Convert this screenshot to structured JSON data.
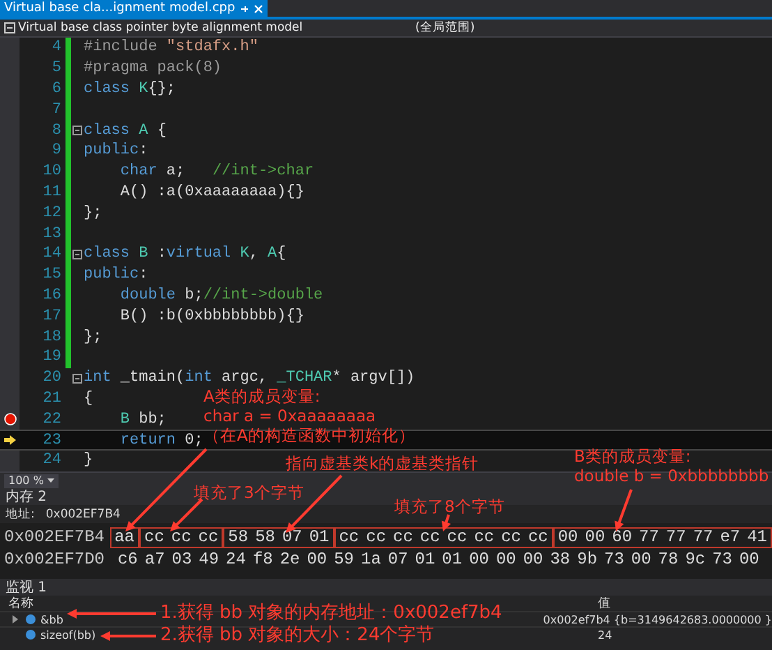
{
  "tab": {
    "title": "Virtual base cla...ignment model.cpp",
    "selected": true
  },
  "nav_bar": {
    "scope": "Virtual base class pointer byte alignment model",
    "member": "(全局范围)"
  },
  "code": {
    "lines": [
      {
        "number": "4",
        "changed": true,
        "tokens": [
          {
            "kind": "pp",
            "text": "#include "
          },
          {
            "kind": "str",
            "text": "\"stdafx.h\""
          }
        ]
      },
      {
        "number": "5",
        "changed": true,
        "tokens": [
          {
            "kind": "pp",
            "text": "#pragma pack(8)"
          }
        ]
      },
      {
        "number": "6",
        "changed": true,
        "tokens": [
          {
            "kind": "kw",
            "text": "class "
          },
          {
            "kind": "ty",
            "text": "K"
          },
          {
            "kind": "pl",
            "text": "{};"
          }
        ]
      },
      {
        "number": "7",
        "changed": true
      },
      {
        "number": "8",
        "changed": true,
        "fold": true,
        "tokens": [
          {
            "kind": "kw",
            "text": "class "
          },
          {
            "kind": "ty",
            "text": "A "
          },
          {
            "kind": "pl",
            "text": "{"
          }
        ]
      },
      {
        "number": "9",
        "changed": true,
        "tokens": [
          {
            "kind": "kw",
            "text": "public"
          },
          {
            "kind": "pl",
            "text": ":"
          }
        ]
      },
      {
        "number": "10",
        "changed": true,
        "tokens": [
          {
            "kind": "kw",
            "text": "    char "
          },
          {
            "kind": "pl",
            "text": "a;   "
          },
          {
            "kind": "cm",
            "text": "//int->char"
          }
        ]
      },
      {
        "number": "11",
        "changed": true,
        "tokens": [
          {
            "kind": "pl",
            "text": "    A() :a(0xaaaaaaaa){}"
          }
        ]
      },
      {
        "number": "12",
        "changed": true,
        "tokens": [
          {
            "kind": "pl",
            "text": "};"
          }
        ]
      },
      {
        "number": "13",
        "changed": true
      },
      {
        "number": "14",
        "changed": true,
        "fold": true,
        "tokens": [
          {
            "kind": "kw",
            "text": "class "
          },
          {
            "kind": "ty",
            "text": "B "
          },
          {
            "kind": "pl",
            "text": ":"
          },
          {
            "kind": "kw",
            "text": "virtual "
          },
          {
            "kind": "ty",
            "text": "K"
          },
          {
            "kind": "pl",
            "text": ", "
          },
          {
            "kind": "ty",
            "text": "A"
          },
          {
            "kind": "pl",
            "text": "{"
          }
        ]
      },
      {
        "number": "15",
        "changed": true,
        "tokens": [
          {
            "kind": "kw",
            "text": "public"
          },
          {
            "kind": "pl",
            "text": ":"
          }
        ]
      },
      {
        "number": "16",
        "changed": true,
        "tokens": [
          {
            "kind": "kw",
            "text": "    double "
          },
          {
            "kind": "pl",
            "text": "b;"
          },
          {
            "kind": "cm",
            "text": "//int->double"
          }
        ]
      },
      {
        "number": "17",
        "changed": true,
        "tokens": [
          {
            "kind": "pl",
            "text": "    B() :b(0xbbbbbbbb){}"
          }
        ]
      },
      {
        "number": "18",
        "changed": true,
        "tokens": [
          {
            "kind": "pl",
            "text": "};"
          }
        ]
      },
      {
        "number": "19",
        "changed": true
      },
      {
        "number": "20",
        "changed": false,
        "fold": true,
        "tokens": [
          {
            "kind": "kw",
            "text": "int "
          },
          {
            "kind": "pl",
            "text": "_tmain("
          },
          {
            "kind": "kw",
            "text": "int "
          },
          {
            "kind": "pl",
            "text": "argc, "
          },
          {
            "kind": "ty",
            "text": "_TCHAR"
          },
          {
            "kind": "pl",
            "text": "* argv[])"
          }
        ]
      },
      {
        "number": "21",
        "changed": false,
        "tokens": [
          {
            "kind": "pl",
            "text": "{"
          }
        ]
      },
      {
        "number": "22",
        "changed": false,
        "breakpoint": true,
        "tokens": [
          {
            "kind": "ty",
            "text": "    B "
          },
          {
            "kind": "pl",
            "text": "bb;"
          }
        ]
      },
      {
        "number": "23",
        "changed": false,
        "current": true,
        "tokens": [
          {
            "kind": "kw",
            "text": "    return "
          },
          {
            "kind": "pl",
            "text": "0;"
          }
        ]
      },
      {
        "number": "24",
        "changed": false,
        "tokens": [
          {
            "kind": "pl",
            "text": "}"
          }
        ]
      }
    ]
  },
  "zoom": "100 %",
  "memory": {
    "title": "内存 2",
    "address_label": "地址:",
    "address": "0x002EF7B4",
    "rows": [
      {
        "address": "0x002EF7B4",
        "groups": [
          {
            "boxed": true,
            "bytes": [
              "aa"
            ]
          },
          {
            "boxed": true,
            "bytes": [
              "cc",
              "cc",
              "cc"
            ]
          },
          {
            "boxed": true,
            "bytes": [
              "58",
              "58",
              "07",
              "01"
            ]
          },
          {
            "boxed": true,
            "bytes": [
              "cc",
              "cc",
              "cc",
              "cc",
              "cc",
              "cc",
              "cc",
              "cc"
            ]
          },
          {
            "boxed": true,
            "bytes": [
              "00",
              "00",
              "60",
              "77",
              "77",
              "77",
              "e7",
              "41"
            ]
          }
        ]
      },
      {
        "address": "0x002EF7D0",
        "groups": [
          {
            "boxed": false,
            "bytes": [
              "c6",
              "a7",
              "03",
              "49",
              "24",
              "f8",
              "2e",
              "00",
              "59",
              "1a",
              "07",
              "01",
              "01",
              "00",
              "00",
              "00",
              "38",
              "9b",
              "73",
              "00",
              "78",
              "9c",
              "73",
              "00"
            ]
          }
        ]
      }
    ]
  },
  "watch": {
    "title": "监视 1",
    "columns": [
      "名称",
      "值"
    ],
    "rows": [
      {
        "name": "&bb",
        "value": "0x002ef7b4 {b=3149642683.0000000 }",
        "expandable": true
      },
      {
        "name": "sizeof(bb)",
        "value": "24",
        "expandable": false
      }
    ]
  },
  "annotations": [
    {
      "lines": [
        "A类的成员变量:",
        "char a = 0xaaaaaaaa",
        "（在A的构造函数中初始化）"
      ]
    },
    {
      "lines": [
        "指向虚基类k的虚基类指针"
      ]
    },
    {
      "lines": [
        "填充了3个字节"
      ]
    },
    {
      "lines": [
        "填充了8个字节"
      ]
    },
    {
      "lines": [
        "B类的成员变量:",
        "double b = 0xbbbbbbbb"
      ]
    },
    {
      "lines": [
        "1.获得 bb 对象的内存地址：0x002ef7b4"
      ]
    },
    {
      "lines": [
        "2.获得 bb 对象的大小：24个字节"
      ]
    }
  ]
}
